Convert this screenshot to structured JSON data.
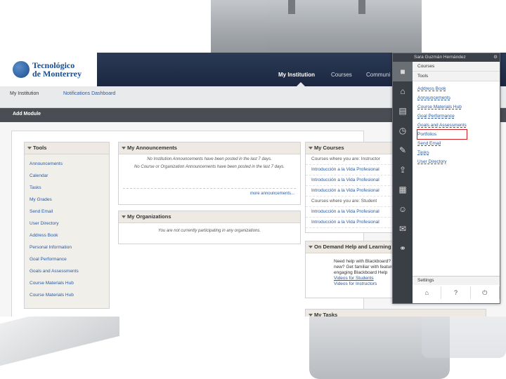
{
  "brand": {
    "line1": "Tecnológico",
    "line2": "de Monterrey"
  },
  "topnav": {
    "tabs": [
      "My Institution",
      "Courses",
      "Communi"
    ]
  },
  "subnav": {
    "items": [
      "My Institution",
      "Notifications Dashboard"
    ]
  },
  "module_bar": {
    "label": "Add Module"
  },
  "tools_module": {
    "title": "Tools",
    "items": [
      "Announcements",
      "Calendar",
      "Tasks",
      "My Grades",
      "Send Email",
      "User Directory",
      "Address Book",
      "Personal Information",
      "Goal Performance",
      "Goals and Assessments",
      "Course Materials Hub",
      "Course Materials Hub"
    ]
  },
  "announcements_module": {
    "title": "My Announcements",
    "msg1": "No Institution Announcements have been posted in the last 7 days.",
    "msg2": "No Course or Organization Announcements have been posted in the last 7 days.",
    "more": "more announcements..."
  },
  "organizations_module": {
    "title": "My Organizations",
    "msg": "You are not currently participating in any organizations."
  },
  "courses_module": {
    "title": "My Courses",
    "rows": [
      "Courses where you are: Instructor",
      "Introducción a la Vida Profesional",
      "Introducción a la Vida Profesional",
      "Introducción a la Vida Profesional",
      "Courses where you are: Student",
      "Introducción a la Vida Profesional",
      "Introducción a la Vida Profesional"
    ]
  },
  "help_module": {
    "title": "On Demand Help and Learning",
    "text": "Need help with Blackboard? new? Get familiar with features engaging Blackboard Help",
    "link1": "Videos for Students",
    "link2": "Videos for Instructors"
  },
  "tasks_module": {
    "title": "My Tasks"
  },
  "global_menu": {
    "user": "Sara Guzmán Hernández",
    "sections": {
      "courses": "Courses",
      "tools": "Tools"
    },
    "items": [
      "Address Book",
      "Announcements",
      "Course Materials Hub",
      "Goal Performance",
      "Goals and Assessments",
      "Portfolios",
      "Send Email",
      "Tasks",
      "User Directory"
    ],
    "settings": "Settings"
  }
}
